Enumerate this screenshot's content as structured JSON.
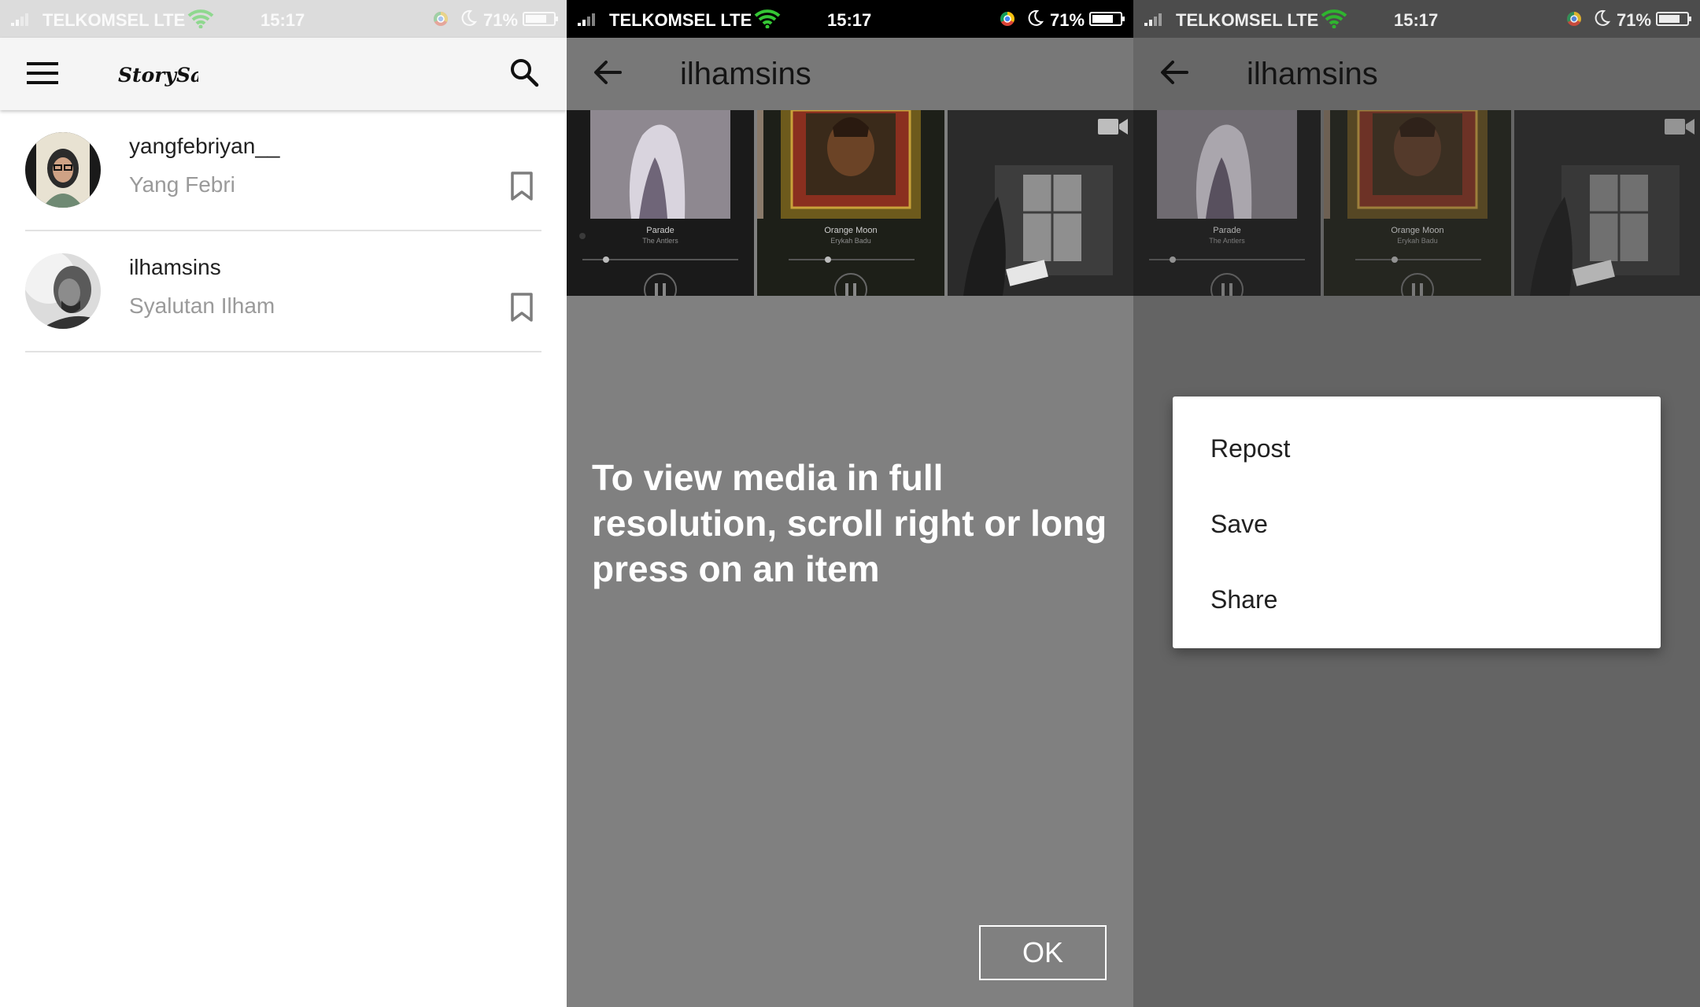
{
  "status_bar": {
    "carrier": "TELKOMSEL LTE",
    "time": "15:17",
    "battery": "71%"
  },
  "home": {
    "app_logo_text": "StorySaver",
    "icons": {
      "menu": "hamburger-menu-icon",
      "search": "search-icon",
      "bookmark": "bookmark-outline-icon"
    },
    "accounts": [
      {
        "username": "yangfebriyan__",
        "full_name": "Yang Febri"
      },
      {
        "username": "ilhamsins",
        "full_name": "Syalutan Ilham"
      }
    ]
  },
  "profile": {
    "title": "ilhamsins",
    "media": [
      {
        "song": "Parade",
        "artist": "The Antlers",
        "type": "image"
      },
      {
        "song": "Orange Moon",
        "artist": "Erykah Badu",
        "type": "image"
      },
      {
        "type": "video"
      }
    ],
    "hint_text": "To view media in full resolution, scroll right or long press on an item",
    "ok_label": "OK"
  },
  "context_menu": {
    "items": [
      "Repost",
      "Save",
      "Share"
    ]
  }
}
